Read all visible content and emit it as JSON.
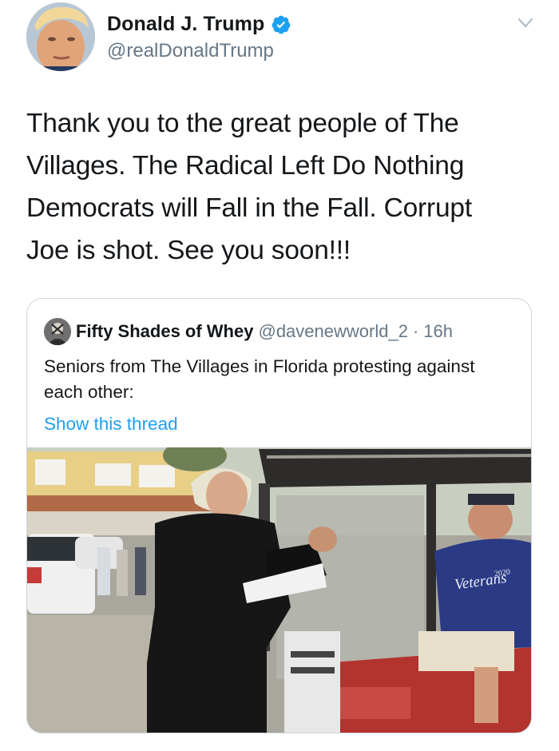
{
  "author": {
    "display_name": "Donald J. Trump",
    "handle": "@realDonaldTrump",
    "verified": true,
    "avatar_icon": "profile-photo"
  },
  "tweet": {
    "text": "Thank you to the great people of The Villages. The Radical Left Do Nothing Democrats will Fall in the Fall. Corrupt Joe is shot. See you soon!!!"
  },
  "quoted_tweet": {
    "display_name": "Fifty Shades of Whey",
    "handle": "@davenewworld_2",
    "separator": "·",
    "time": "16h",
    "text": "Seniors from The Villages in Florida protesting against each other:",
    "show_thread": "Show this thread",
    "media": {
      "type": "video-still",
      "shirt_text": "Veterans",
      "shirt_year": "2020"
    }
  },
  "colors": {
    "link": "#1da1f2",
    "verified": "#1da1f2",
    "secondary_text": "#657786",
    "border": "#ccd6dd"
  }
}
